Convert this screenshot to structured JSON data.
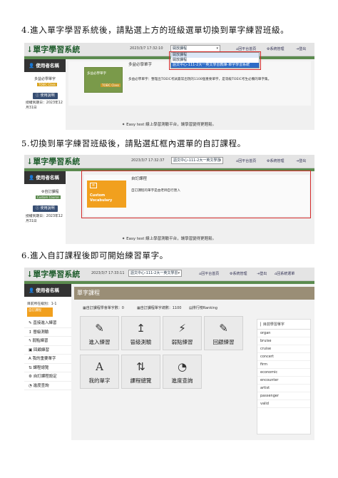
{
  "step4": {
    "instruction": "4.進入單字學習系統後，請點選上方的班級選單切換到單字練習班級。",
    "app_title": "單字學習系統",
    "datetime": "2023/3/7 17:32:10",
    "select_value": "開放課程",
    "dropdown_options": [
      "開放課程",
      "語文中心-111-2大一英文學習教練-單字學習系統"
    ],
    "nav_home": "回平台首頁",
    "nav_admin": "系統管理",
    "nav_logout": "登出",
    "sidebar_title": "使用者名稱",
    "course_logo_text": "多益必學單字",
    "course_logo_chip": "TOEIC Class",
    "help_button": "使用說明",
    "auth_date": "授權到期日：2023年12月31日",
    "course_title": "多益必學單字",
    "course_image_title": "多益必學單字",
    "course_image_sub": "TOEIC Class",
    "course_desc": "多益必學單字：整理出TOEIC考試最常出現的1100個重要單字，是等級TOEIC考生必備的單字集。",
    "footer": "Easy test 線上學習測驗平台，讓學習變得更輕鬆。"
  },
  "step5": {
    "instruction": "5.切換到單字練習班級後，請點選紅框內選單的自訂課程。",
    "app_title": "單字學習系統",
    "datetime": "2023/3/7 17:32:37",
    "select_value": "語文中心-111-2大一英文學習",
    "nav_home": "回平台首頁",
    "nav_admin": "系統管理",
    "nav_logout": "登出",
    "sidebar_title": "使用者名稱",
    "custom_label": "自訂課程",
    "custom_chip": "Custom Course",
    "help_button": "使用說明",
    "auth_date": "授權到期日：2023年12月31日",
    "course_title": "自訂課程",
    "card_title": "Custom",
    "card_sub": "Vocabulary",
    "course_desc": "自訂課程的單字是由老師自行匯入",
    "footer": "Easy test 線上學習測驗平台，讓學習變得更輕鬆。"
  },
  "step6": {
    "instruction": "6.進入自訂課程後即可開始練習單字。",
    "app_title": "單字學習系統",
    "datetime": "2023/3/7 17:33:11",
    "select_value": "語文中心-111-2大一英文學習",
    "nav_home": "回平台首頁",
    "nav_admin": "系統管理",
    "nav_logout": "登出",
    "nav_back": "回系統選單",
    "sidebar_title": "使用者名稱",
    "level": "目前所在級別：1-1",
    "custom_label": "自訂課程",
    "menu": [
      "直接進入練習",
      "晉級測驗",
      "弱點練習",
      "回顧練習",
      "我的重要單字",
      "課程總覽",
      "自訂課程設定",
      "進度查詢"
    ],
    "menu_icons": [
      "pencil-icon",
      "arrow-up-icon",
      "bolt-icon",
      "edit-icon",
      "letter-a-icon",
      "sort-icon",
      "gear-icon",
      "clock-icon"
    ],
    "banner": "單字課程",
    "stats": [
      "自訂課程學會單字數：0",
      "自訂課程單字總數：1100",
      "排行榜Ranking"
    ],
    "tiles": [
      "進入練習",
      "晉級測驗",
      "弱點練習",
      "回顧練習",
      "我的單字",
      "課程總覽",
      "進度查詢"
    ],
    "tile_glyphs": [
      "✎",
      "↥",
      "⚡",
      "✎",
      "A",
      "⇅",
      "◔"
    ],
    "wordlist_title": "目前學習單字",
    "words": [
      "organ",
      "bruise",
      "cruise",
      "concert",
      "firm",
      "economic",
      "encounter",
      "artist",
      "passenger",
      "valid"
    ]
  },
  "colors": {
    "accent_green": "#5b8b4f",
    "sidebar_dark": "#333333",
    "highlight_red": "#d42b2b",
    "orange": "#f1a01e",
    "button_blue": "#374e73"
  }
}
